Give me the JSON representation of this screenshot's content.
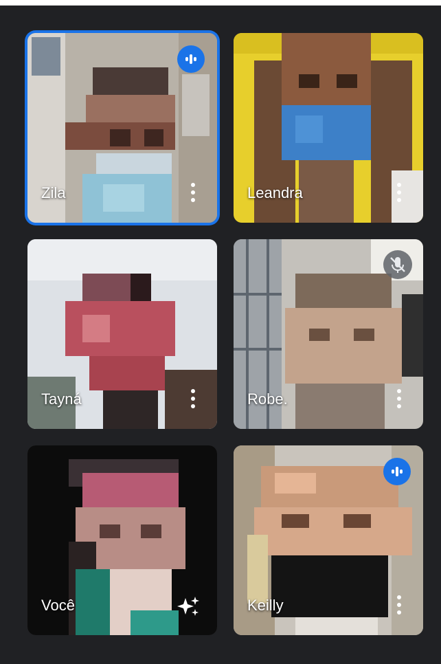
{
  "participants": [
    {
      "name": "Zila",
      "speaking": true,
      "active": true
    },
    {
      "name": "Leandra"
    },
    {
      "name": "Tayná"
    },
    {
      "name": "Robe.",
      "muted": true
    },
    {
      "name": "Você"
    },
    {
      "name": "Keilly",
      "speaking": true
    }
  ],
  "icons": {
    "speaking": "audio-level-icon",
    "muted": "mic-off-icon",
    "more": "more-vert-icon",
    "effects": "sparkle-effects-icon"
  },
  "colors": {
    "background": "#202124",
    "accent": "#1a73e8",
    "name_text": "#ffffff"
  }
}
